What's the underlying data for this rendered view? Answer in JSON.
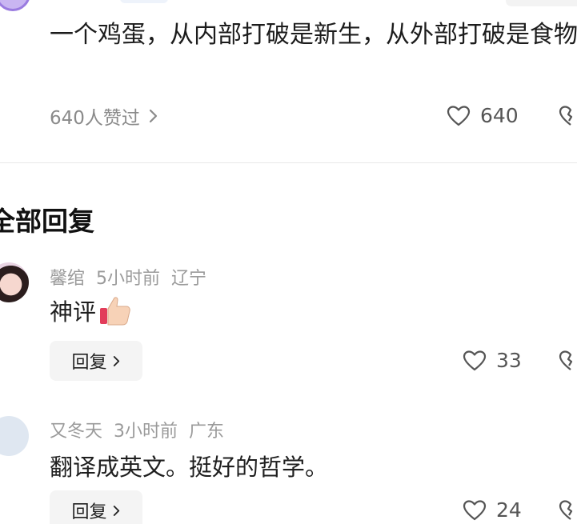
{
  "post": {
    "text": "一个鸡蛋，从内部打破是新生，从外部打破是食物。",
    "liked_by": "640人赞过",
    "like_count": "640"
  },
  "section": {
    "title": "全部回复"
  },
  "comments": [
    {
      "author": "馨绾",
      "time": "5小时前",
      "location": "辽宁",
      "text": "神评",
      "reply_label": "回复",
      "like_count": "33"
    },
    {
      "author": "又冬天",
      "time": "3小时前",
      "location": "广东",
      "text": "翻译成英文。挺好的哲学。",
      "reply_label": "回复",
      "like_count": "24"
    }
  ],
  "icons": {
    "heart": "heart-icon",
    "dislike": "broken-heart-icon",
    "chevron": "chevron-right-icon",
    "thumbs_up_emoji": "thumbs-up-emoji"
  },
  "colors": {
    "muted_text": "#8a8a8a",
    "divider": "#e8e8e8",
    "reply_bg": "#f4f4f4"
  }
}
